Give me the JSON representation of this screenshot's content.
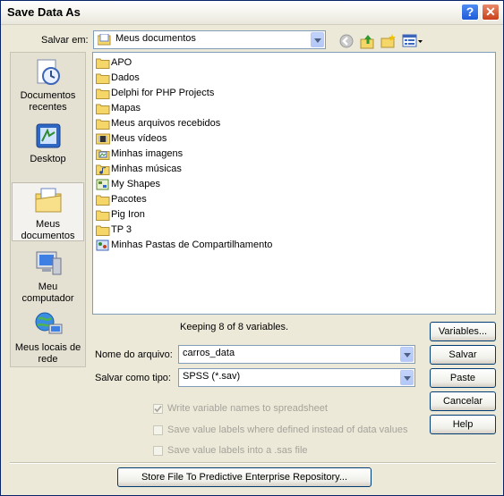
{
  "window": {
    "title": "Save Data As"
  },
  "titlebar": {
    "help_label": "?",
    "close_label": "✕"
  },
  "save_in": {
    "label": "Salvar em:",
    "value": "Meus documentos"
  },
  "toolbar": {
    "icons": [
      "back-icon",
      "up-folder-icon",
      "new-folder-icon",
      "view-menu-icon"
    ]
  },
  "places": [
    {
      "label": "Documentos recentes",
      "icon": "recent-documents-icon"
    },
    {
      "label": "Desktop",
      "icon": "desktop-icon"
    },
    {
      "label": "Meus documentos",
      "icon": "my-documents-icon",
      "selected": true
    },
    {
      "label": "Meu computador",
      "icon": "my-computer-icon"
    },
    {
      "label": "Meus locais de rede",
      "icon": "network-places-icon"
    }
  ],
  "files": [
    {
      "name": "APO",
      "icon": "folder-icon"
    },
    {
      "name": "Dados",
      "icon": "folder-icon"
    },
    {
      "name": "Delphi for PHP Projects",
      "icon": "folder-icon"
    },
    {
      "name": "Mapas",
      "icon": "folder-icon"
    },
    {
      "name": "Meus arquivos recebidos",
      "icon": "folder-icon"
    },
    {
      "name": "Meus vídeos",
      "icon": "videos-folder-icon"
    },
    {
      "name": "Minhas imagens",
      "icon": "pictures-folder-icon"
    },
    {
      "name": "Minhas músicas",
      "icon": "music-folder-icon"
    },
    {
      "name": "My Shapes",
      "icon": "shapes-folder-icon"
    },
    {
      "name": "Pacotes",
      "icon": "folder-icon"
    },
    {
      "name": "Pig Iron",
      "icon": "folder-icon"
    },
    {
      "name": "TP 3",
      "icon": "folder-icon"
    },
    {
      "name": "Minhas Pastas de Compartilhamento",
      "icon": "shared-folder-icon"
    }
  ],
  "status": "Keeping 8 of 8 variables.",
  "filename": {
    "label": "Nome do arquivo:",
    "value": "carros_data"
  },
  "filetype": {
    "label": "Salvar como tipo:",
    "value": "SPSS (*.sav)"
  },
  "buttons": {
    "variables": "Variables...",
    "save": "Salvar",
    "paste": "Paste",
    "cancel": "Cancelar",
    "help": "Help",
    "store": "Store File To Predictive Enterprise Repository..."
  },
  "options": [
    {
      "label": "Write variable names to spreadsheet",
      "checked": true,
      "enabled": false
    },
    {
      "label": "Save value labels where defined instead of data values",
      "checked": false,
      "enabled": false
    },
    {
      "label": "Save value labels into a .sas file",
      "checked": false,
      "enabled": false
    }
  ],
  "colors": {
    "title_bar": "#ffffff",
    "accent": "#316ac5",
    "dialog_bg": "#ece9d8",
    "folder": "#f5d769"
  }
}
